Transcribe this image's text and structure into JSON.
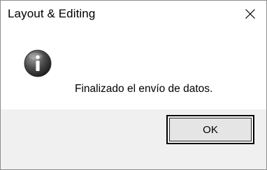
{
  "dialog": {
    "title": "Layout & Editing",
    "message": "Finalizado el envío de datos.",
    "icon": "info-icon",
    "close_icon": "close-icon",
    "ok_label": "OK"
  },
  "colors": {
    "footer_background": "#f0f0f0",
    "button_face": "#e5e5e5",
    "button_border": "#000000",
    "window_border": "#8c8c8c"
  }
}
